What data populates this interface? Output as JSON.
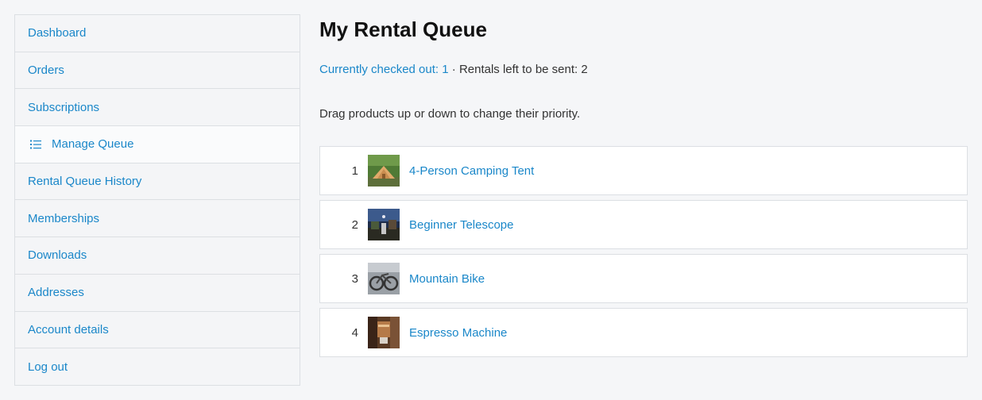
{
  "sidebar": {
    "items": [
      {
        "label": "Dashboard"
      },
      {
        "label": "Orders"
      },
      {
        "label": "Subscriptions"
      },
      {
        "label": "Manage Queue",
        "icon": "list-icon",
        "active": true
      },
      {
        "label": "Rental Queue History"
      },
      {
        "label": "Memberships"
      },
      {
        "label": "Downloads"
      },
      {
        "label": "Addresses"
      },
      {
        "label": "Account details"
      },
      {
        "label": "Log out"
      }
    ]
  },
  "main": {
    "title": "My Rental Queue",
    "checked_out_link": "Currently checked out: 1",
    "separator": " · ",
    "rentals_left": "Rentals left to be sent: 2",
    "instructions": "Drag products up or down to change their priority.",
    "queue": [
      {
        "position": "1",
        "name": "4-Person Camping Tent",
        "thumb": "tent-thumbnail"
      },
      {
        "position": "2",
        "name": "Beginner Telescope",
        "thumb": "telescope-thumbnail"
      },
      {
        "position": "3",
        "name": "Mountain Bike",
        "thumb": "bike-thumbnail"
      },
      {
        "position": "4",
        "name": "Espresso Machine",
        "thumb": "espresso-thumbnail"
      }
    ]
  },
  "colors": {
    "link": "#1a87c9",
    "border": "#dcdfe3",
    "background": "#f5f6f8"
  }
}
